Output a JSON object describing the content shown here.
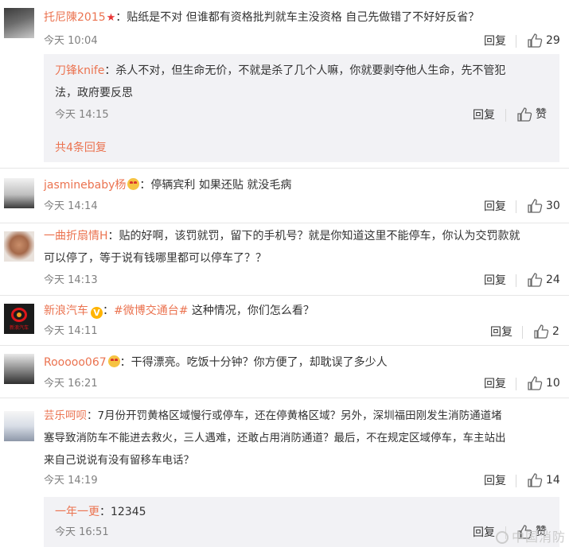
{
  "comments": [
    {
      "user": "托尼陳2015",
      "text": "：贴纸是不对 但谁都有资格批判就车主没资格 自己先做错了不好好反省？",
      "time": "今天 10:04",
      "reply_label": "回复",
      "likes": "29",
      "subreply": {
        "user": "刀锋knife",
        "text_line1": "：杀人不对，但生命无价，不就是杀了几个人嘛，你就要剥夺他人生命，先不管犯",
        "text_line2": "法，政府要反思",
        "time": "今天 14:15",
        "reply_label": "回复",
        "like_label": "赞"
      },
      "more_label": "共4条回复"
    },
    {
      "user": "jasminebaby杨",
      "text": "：停辆宾利  如果还贴 就没毛病",
      "time": "今天 14:14",
      "reply_label": "回复",
      "likes": "30"
    },
    {
      "user": "一曲折扇情H",
      "text_line1": "：贴的好啊，该罚就罚，留下的手机号？就是你知道这里不能停车，你认为交罚款就",
      "text_line2": "可以停了，等于说有钱哪里都可以停车了？？",
      "time": "今天 14:13",
      "reply_label": "回复",
      "likes": "24"
    },
    {
      "user": "新浪汽车",
      "topic": "#微博交通台#",
      "text": " 这种情况，你们怎么看？",
      "time": "今天 14:11",
      "reply_label": "回复",
      "likes": "2",
      "avatar_text": "新浪汽车"
    },
    {
      "user": "Rooooo067",
      "text": "：干得漂亮。吃饭十分钟？你方便了，却耽误了多少人",
      "time": "今天 16:21",
      "reply_label": "回复",
      "likes": "10"
    },
    {
      "user": "芸乐呵呗",
      "text_line1": "：7月份开罚黄格区域慢行或停车，还在停黄格区域？另外，深圳福田刚发生消防通道堵",
      "text_line2": "塞导致消防车不能进去救火，三人遇难，还敢占用消防通道？最后，不在规定区域停车，车主站出",
      "text_line3": "来自己说说有没有留移车电话？",
      "time": "今天 14:19",
      "reply_label": "回复",
      "likes": "14",
      "subreply": {
        "user": "一年一更",
        "text": "：12345",
        "time": "今天 16:51",
        "reply_label": "回复",
        "like_label": "赞"
      }
    }
  ],
  "watermark": "中国消防",
  "colors": {
    "accent": "#eb7350",
    "text": "#333333",
    "muted": "#808080",
    "panel": "#f2f2f5"
  }
}
